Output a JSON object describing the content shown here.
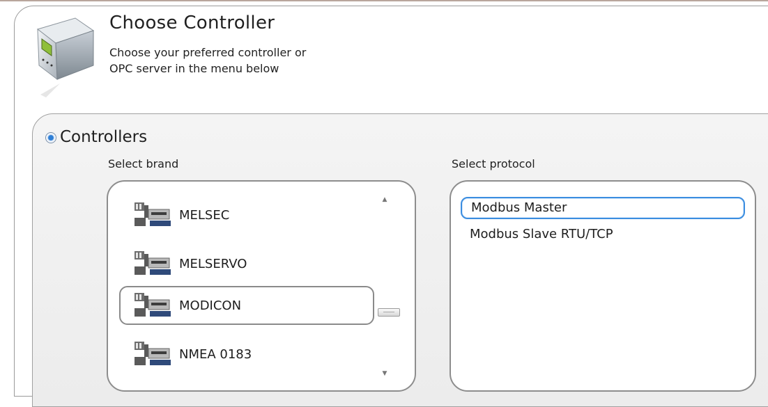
{
  "header": {
    "title": "Choose Controller",
    "subtitle_line1": "Choose your preferred controller or",
    "subtitle_line2": "OPC server in the menu below",
    "icon": "plc-device-icon"
  },
  "controllers": {
    "radio_label": "Controllers",
    "radio_selected": true,
    "brand_label": "Select brand",
    "protocol_label": "Select protocol",
    "brands": [
      {
        "label": "MELSEC",
        "selected": false
      },
      {
        "label": "MELSERVO",
        "selected": false
      },
      {
        "label": "MODICON",
        "selected": true
      },
      {
        "label": "NMEA 0183",
        "selected": false
      }
    ],
    "protocols": [
      {
        "label": "Modbus Master",
        "selected": true
      },
      {
        "label": "Modbus Slave RTU/TCP",
        "selected": false
      }
    ]
  },
  "colors": {
    "selection_border": "#3b8de0",
    "panel_border": "#9a9a9a",
    "panel_background": "#f0f0f0"
  }
}
